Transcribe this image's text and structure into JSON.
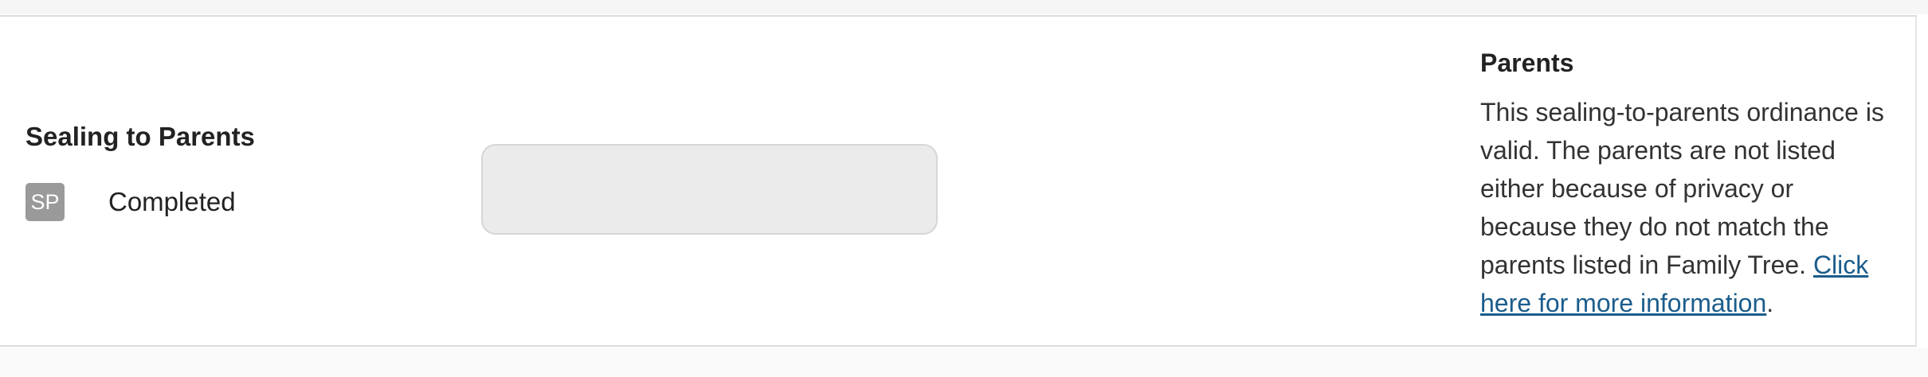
{
  "ordinance": {
    "title": "Sealing to Parents",
    "badge": "SP",
    "status": "Completed"
  },
  "info": {
    "title": "Parents",
    "text": "This sealing-to-parents ordinance is valid. The parents are not listed either because of privacy or because they do not match the parents listed in Family Tree. ",
    "link_text": "Click here for more information",
    "trailing": "."
  }
}
